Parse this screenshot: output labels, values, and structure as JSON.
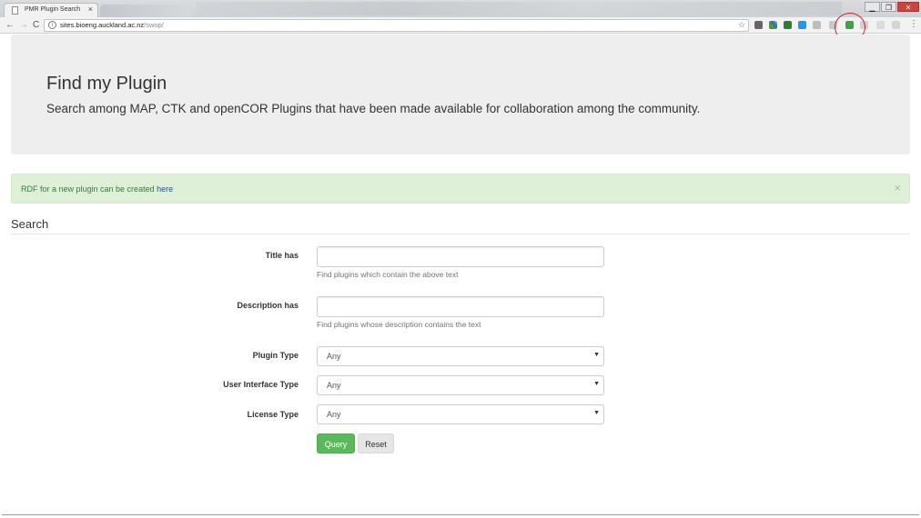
{
  "browser": {
    "tab_title": "PMR Plugin Search",
    "tab_close": "×",
    "url_host": "sites.bioeng.auckland.ac.nz",
    "url_path": "/swop/",
    "window_controls": [
      "▁",
      "❐",
      "✕"
    ],
    "nav": {
      "back": "←",
      "forward": "→",
      "reload": "C"
    },
    "star_icon": "☆",
    "menu_icon": "⋮"
  },
  "header": {
    "title": "Find my Plugin",
    "subtitle": "Search among MAP, CTK and openCOR Plugins that have been made available for collaboration among the community."
  },
  "alert": {
    "text": "RDF for a new plugin can be created ",
    "link": "here",
    "close": "×"
  },
  "search": {
    "section_title": "Search",
    "title_label": "Title has",
    "title_value": "",
    "title_help": "Find plugins which contain the above text",
    "description_label": "Description has",
    "description_value": "",
    "description_help": "Find plugins whose description contains the text",
    "plugin_type_label": "Plugin Type",
    "plugin_type_value": "Any",
    "ui_type_label": "User Interface Type",
    "ui_type_value": "Any",
    "license_label": "License Type",
    "license_value": "Any",
    "select_arrow": "▼",
    "query_button": "Query",
    "reset_button": "Reset"
  },
  "colors": {
    "jumbotron_bg": "#eeeeee",
    "alert_bg": "#dff0d8",
    "alert_text": "#3c763d",
    "link": "#245580",
    "query_btn": "#5cb85c",
    "highlight_circle": "#d0202a"
  }
}
